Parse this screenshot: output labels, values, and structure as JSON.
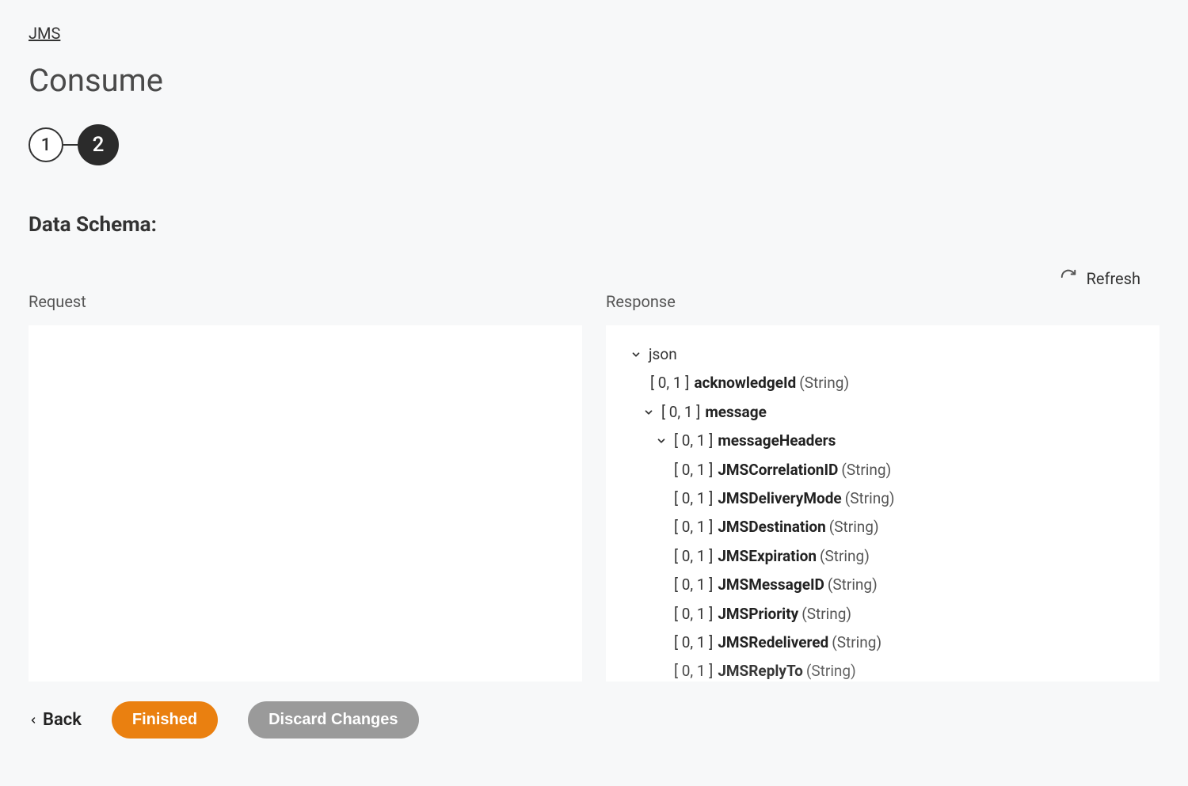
{
  "breadcrumb": {
    "label": "JMS"
  },
  "header": {
    "title": "Consume"
  },
  "stepper": {
    "step1": "1",
    "step2": "2"
  },
  "section": {
    "title": "Data Schema:"
  },
  "refresh": {
    "label": "Refresh"
  },
  "panels": {
    "request_label": "Request",
    "response_label": "Response"
  },
  "tree": {
    "root": "json",
    "items": [
      {
        "card": "[ 0, 1 ]",
        "name": "acknowledgeId",
        "type": "(String)"
      },
      {
        "card": "[ 0, 1 ]",
        "name": "message",
        "type": ""
      },
      {
        "card": "[ 0, 1 ]",
        "name": "messageHeaders",
        "type": ""
      },
      {
        "card": "[ 0, 1 ]",
        "name": "JMSCorrelationID",
        "type": "(String)"
      },
      {
        "card": "[ 0, 1 ]",
        "name": "JMSDeliveryMode",
        "type": "(String)"
      },
      {
        "card": "[ 0, 1 ]",
        "name": "JMSDestination",
        "type": "(String)"
      },
      {
        "card": "[ 0, 1 ]",
        "name": "JMSExpiration",
        "type": "(String)"
      },
      {
        "card": "[ 0, 1 ]",
        "name": "JMSMessageID",
        "type": "(String)"
      },
      {
        "card": "[ 0, 1 ]",
        "name": "JMSPriority",
        "type": "(String)"
      },
      {
        "card": "[ 0, 1 ]",
        "name": "JMSRedelivered",
        "type": "(String)"
      },
      {
        "card": "[ 0, 1 ]",
        "name": "JMSReplyTo",
        "type": "(String)"
      }
    ]
  },
  "footer": {
    "back": "Back",
    "finished": "Finished",
    "discard": "Discard Changes"
  }
}
